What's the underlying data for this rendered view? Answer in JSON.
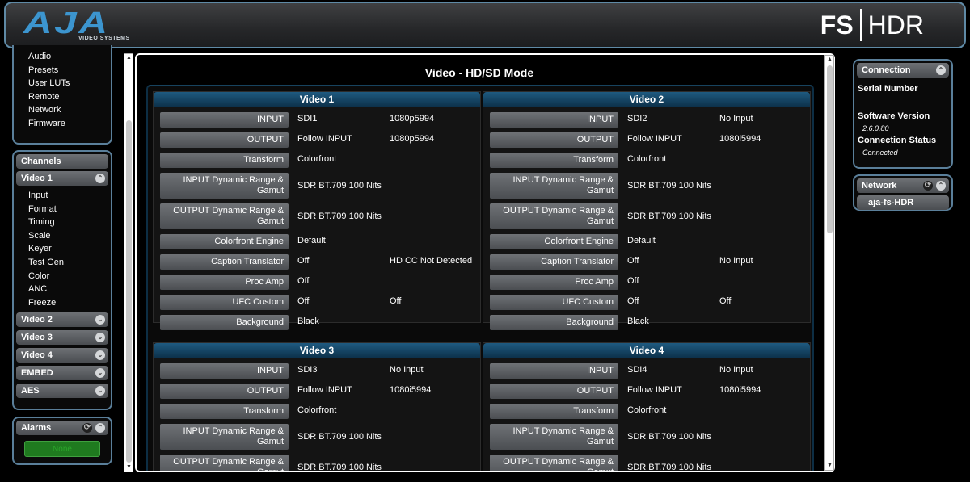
{
  "header": {
    "logo_text": "AJA",
    "logo_sub": "VIDEO SYSTEMS",
    "product_fs": "FS",
    "product_hdr": "HDR"
  },
  "nav_top": [
    "Audio",
    "Presets",
    "User LUTs",
    "Remote",
    "Network",
    "Firmware"
  ],
  "channels": {
    "title": "Channels",
    "video1": "Video 1",
    "video1_items": [
      "Input",
      "Format",
      "Timing",
      "Scale",
      "Keyer",
      "Test Gen",
      "Color",
      "ANC",
      "Freeze"
    ],
    "collapsed": [
      "Video 2",
      "Video 3",
      "Video 4",
      "EMBED",
      "AES"
    ]
  },
  "alarms": {
    "title": "Alarms",
    "status": "None"
  },
  "main": {
    "title": "Video - HD/SD Mode"
  },
  "cards": [
    {
      "title": "Video 1",
      "rows": [
        {
          "label": "INPUT",
          "v1": "SDI1",
          "v2": "1080p5994"
        },
        {
          "label": "OUTPUT",
          "v1": "Follow INPUT",
          "v2": "1080p5994"
        },
        {
          "label": "Transform",
          "v1": "Colorfront",
          "v2": ""
        },
        {
          "label": "INPUT Dynamic Range & Gamut",
          "v1": "SDR BT.709 100 Nits",
          "v2": "",
          "tall": true
        },
        {
          "label": "OUTPUT Dynamic Range & Gamut",
          "v1": "SDR BT.709 100 Nits",
          "v2": "",
          "tall": true
        },
        {
          "label": "Colorfront Engine",
          "v1": "Default",
          "v2": ""
        },
        {
          "label": "Caption Translator",
          "v1": "Off",
          "v2": "HD CC Not Detected"
        },
        {
          "label": "Proc Amp",
          "v1": "Off",
          "v2": ""
        },
        {
          "label": "UFC Custom",
          "v1": "Off",
          "v2": "Off"
        },
        {
          "label": "Background",
          "v1": "Black",
          "v2": ""
        }
      ]
    },
    {
      "title": "Video 2",
      "rows": [
        {
          "label": "INPUT",
          "v1": "SDI2",
          "v2": "No Input"
        },
        {
          "label": "OUTPUT",
          "v1": "Follow INPUT",
          "v2": "1080i5994"
        },
        {
          "label": "Transform",
          "v1": "Colorfront",
          "v2": ""
        },
        {
          "label": "INPUT Dynamic Range & Gamut",
          "v1": "SDR BT.709 100 Nits",
          "v2": "",
          "tall": true
        },
        {
          "label": "OUTPUT Dynamic Range & Gamut",
          "v1": "SDR BT.709 100 Nits",
          "v2": "",
          "tall": true
        },
        {
          "label": "Colorfront Engine",
          "v1": "Default",
          "v2": ""
        },
        {
          "label": "Caption Translator",
          "v1": "Off",
          "v2": "No Input"
        },
        {
          "label": "Proc Amp",
          "v1": "Off",
          "v2": ""
        },
        {
          "label": "UFC Custom",
          "v1": "Off",
          "v2": "Off"
        },
        {
          "label": "Background",
          "v1": "Black",
          "v2": ""
        }
      ]
    },
    {
      "title": "Video 3",
      "rows": [
        {
          "label": "INPUT",
          "v1": "SDI3",
          "v2": "No Input"
        },
        {
          "label": "OUTPUT",
          "v1": "Follow INPUT",
          "v2": "1080i5994"
        },
        {
          "label": "Transform",
          "v1": "Colorfront",
          "v2": ""
        },
        {
          "label": "INPUT Dynamic Range & Gamut",
          "v1": "SDR BT.709 100 Nits",
          "v2": "",
          "tall": true
        },
        {
          "label": "OUTPUT Dynamic Range & Gamut",
          "v1": "SDR BT.709 100 Nits",
          "v2": "",
          "tall": true
        }
      ]
    },
    {
      "title": "Video 4",
      "rows": [
        {
          "label": "INPUT",
          "v1": "SDI4",
          "v2": "No Input"
        },
        {
          "label": "OUTPUT",
          "v1": "Follow INPUT",
          "v2": "1080i5994"
        },
        {
          "label": "Transform",
          "v1": "Colorfront",
          "v2": ""
        },
        {
          "label": "INPUT Dynamic Range & Gamut",
          "v1": "SDR BT.709 100 Nits",
          "v2": "",
          "tall": true
        },
        {
          "label": "OUTPUT Dynamic Range & Gamut",
          "v1": "SDR BT.709 100 Nits",
          "v2": "",
          "tall": true
        }
      ]
    }
  ],
  "connection": {
    "title": "Connection",
    "serial_label": "Serial Number",
    "serial_value": "",
    "sw_label": "Software Version",
    "sw_value": "2.6.0.80",
    "status_label": "Connection Status",
    "status_value": "Connected"
  },
  "network": {
    "title": "Network",
    "host": "aja-fs-HDR"
  },
  "colors": {
    "accent": "#5a7f9a",
    "card_header": "#1f5a80",
    "alarm_ok": "#1f7a1f",
    "logo": "#3c95cf"
  },
  "icons": {
    "toggle": "collapse-icon",
    "refresh": "refresh-icon"
  }
}
